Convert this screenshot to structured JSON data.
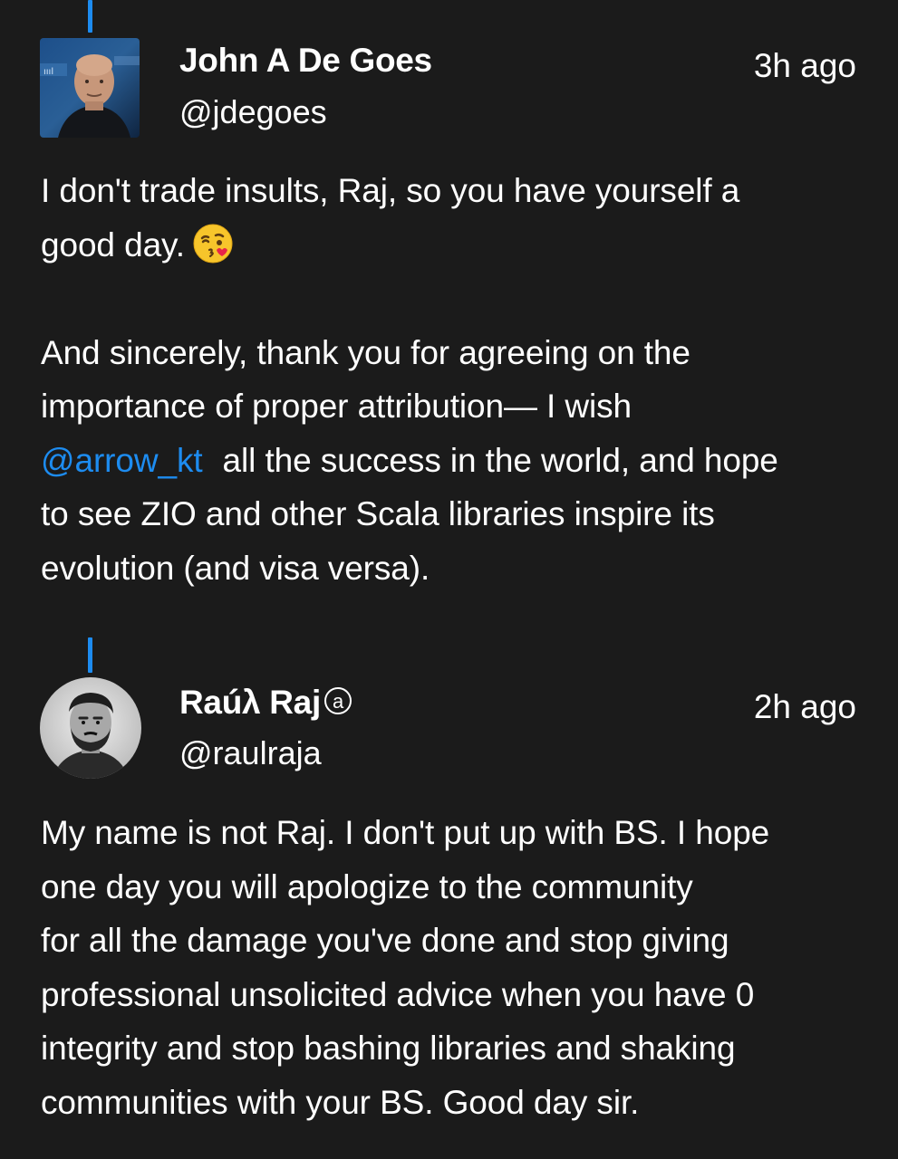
{
  "posts": [
    {
      "name": "John A De Goes",
      "handle": "@jdegoes",
      "time": "3h ago",
      "lines": [
        "I don't trade insults, Raj, so you have yourself a",
        "good day.",
        "",
        "And sincerely, thank you for agreeing on the",
        "importance of proper attribution— I wish",
        "all the success in the world, and hope",
        "to see ZIO and other Scala libraries inspire its",
        "evolution (and visa versa)."
      ],
      "mention": "@arrow_kt",
      "emoji": "face-blowing-kiss-icon"
    },
    {
      "name": "Raúλ Raj",
      "verified_glyph": "a",
      "handle": "@raulraja",
      "time": "2h ago",
      "lines": [
        "My name is not Raj. I don't put up with BS. I hope",
        "one day you will apologize to the community",
        "for all the damage you've done and stop giving",
        "professional unsolicited advice when you have 0",
        "integrity and stop bashing libraries and shaking",
        "communities with your BS. Good day sir."
      ]
    }
  ],
  "colors": {
    "background": "#1b1b1b",
    "text": "#ffffff",
    "accent": "#1d8cf0"
  }
}
